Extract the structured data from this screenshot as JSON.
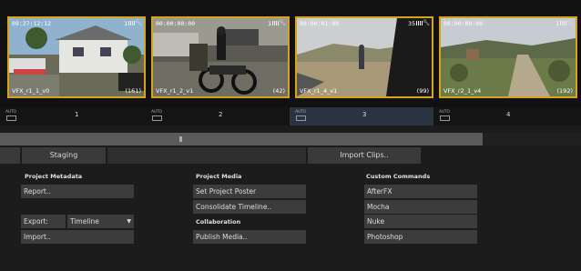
{
  "thumbnails": [
    {
      "timecode": "09:27:12:12",
      "count": "1",
      "name": "VFX_r1_1_v0",
      "frames": "(161)"
    },
    {
      "timecode": "00:00:00:00",
      "count": "1",
      "name": "VFX_r1_2_v1",
      "frames": "(42)"
    },
    {
      "timecode": "00:00:01:09",
      "count": "35",
      "name": "VFX_r1_4_v1",
      "frames": "(99)"
    },
    {
      "timecode": "00:00:00:00",
      "count": "1",
      "name": "VFX_r2_1_v4",
      "frames": "(192)"
    }
  ],
  "track": {
    "auto_label": "AUTO",
    "segments": [
      "1",
      "2",
      "3",
      "4"
    ],
    "active_segment": "3"
  },
  "tabs": {
    "staging": "Staging",
    "import_clips": "Import Clips.."
  },
  "project_metadata": {
    "header": "Project Metadata",
    "report": "Report..",
    "export_label": "Export:",
    "export_value": "Timeline",
    "import": "Import.."
  },
  "project_media": {
    "header": "Project Media",
    "set_poster": "Set Project Poster",
    "consolidate": "Consolidate Timeline..",
    "collaboration_header": "Collaboration",
    "publish": "Publish Media.."
  },
  "custom_commands": {
    "header": "Custom Commands",
    "items": [
      "AfterFX",
      "Mocha",
      "Nuke",
      "Photoshop"
    ]
  },
  "colors": {
    "thumb_border": "#d9a21b",
    "active_segment": "#2a3440"
  }
}
